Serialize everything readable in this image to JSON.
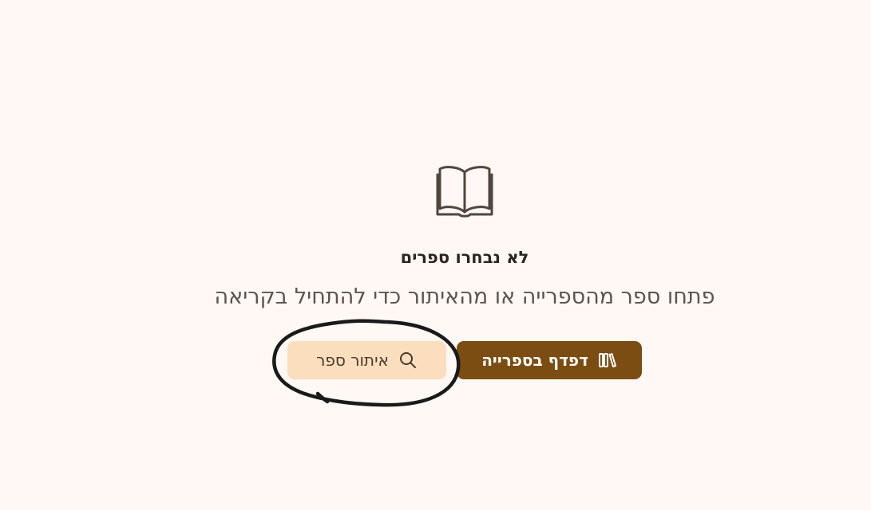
{
  "empty_state": {
    "icon": "open-book-icon",
    "title": "לא נבחרו ספרים",
    "subtitle": "פתחו ספר מהספרייה או מהאיתור כדי להתחיל בקריאה"
  },
  "actions": {
    "browse_label": "דפדף בספרייה",
    "browse_icon": "library-icon",
    "find_label": "איתור ספר",
    "find_icon": "search-icon"
  },
  "colors": {
    "background": "#fff8f4",
    "primary_button": "#7b4d12",
    "secondary_button": "#fbdebd",
    "annotation_stroke": "#1a1a1a"
  }
}
